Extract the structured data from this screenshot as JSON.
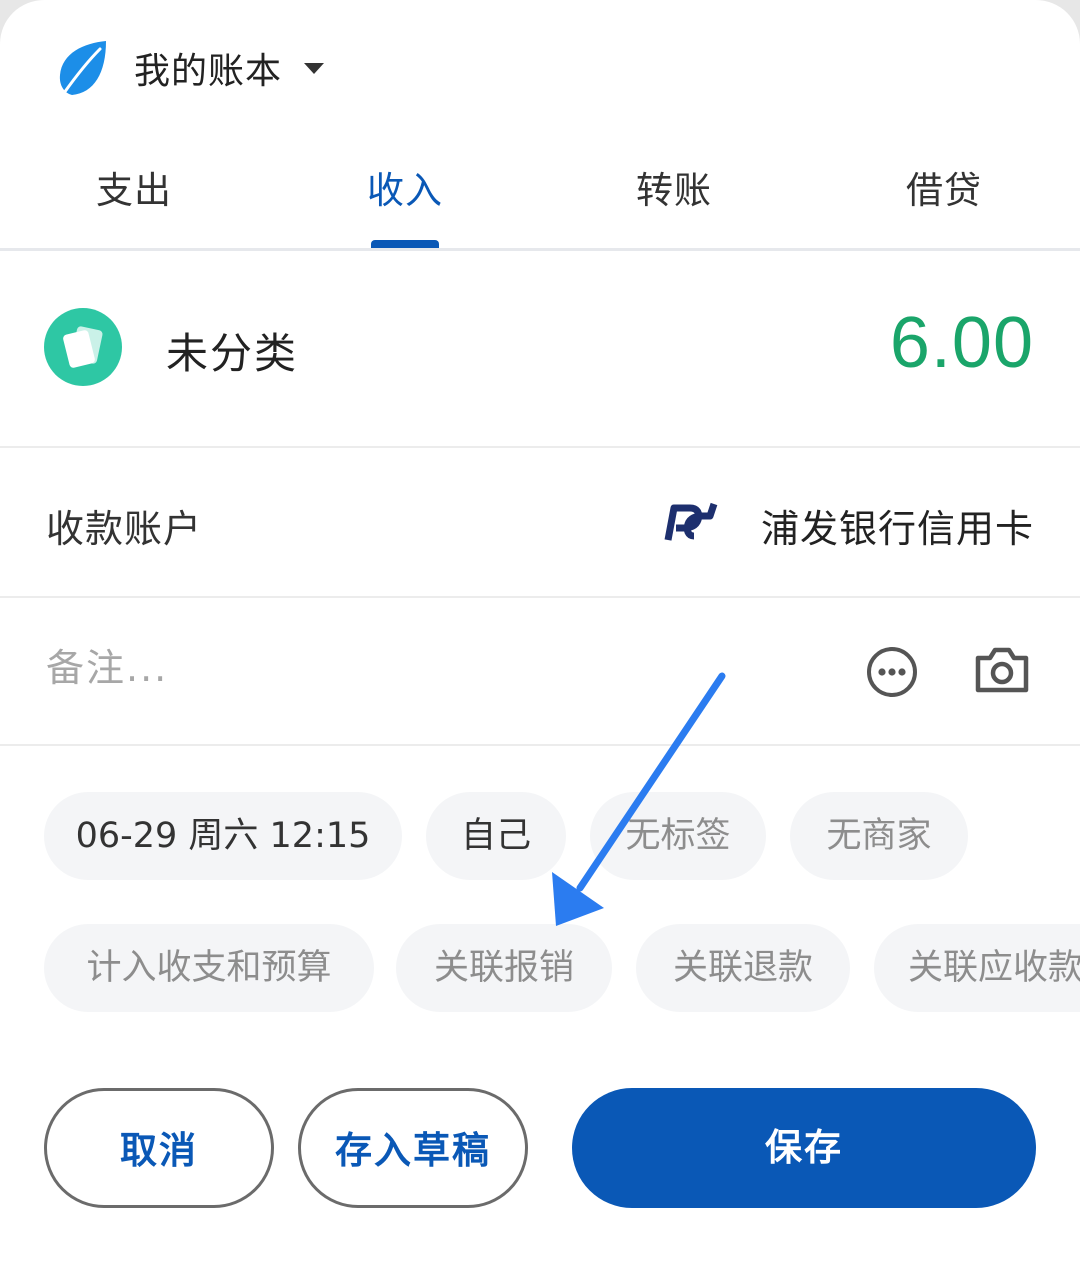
{
  "header": {
    "book_title": "我的账本"
  },
  "tabs": [
    {
      "label": "支出",
      "active": false
    },
    {
      "label": "收入",
      "active": true
    },
    {
      "label": "转账",
      "active": false
    },
    {
      "label": "借贷",
      "active": false
    }
  ],
  "category": {
    "label": "未分类",
    "amount": "6.00",
    "icon": "card-icon",
    "icon_color": "#2ec7a4",
    "amount_color": "#1aa56a"
  },
  "account": {
    "label": "收款账户",
    "value": "浦发银行信用卡",
    "icon": "spdb-bank-logo"
  },
  "note": {
    "placeholder": "备注..."
  },
  "chips_row1": [
    "06-29 周六 12:15",
    "自己",
    "无标签",
    "无商家"
  ],
  "chips_row2": [
    "计入收支和预算",
    "关联报销",
    "关联退款",
    "关联应收款"
  ],
  "buttons": {
    "cancel": "取消",
    "draft": "存入草稿",
    "save": "保存"
  },
  "colors": {
    "accent": "#0a58b6",
    "annotation_arrow": "#2b7cf0"
  }
}
